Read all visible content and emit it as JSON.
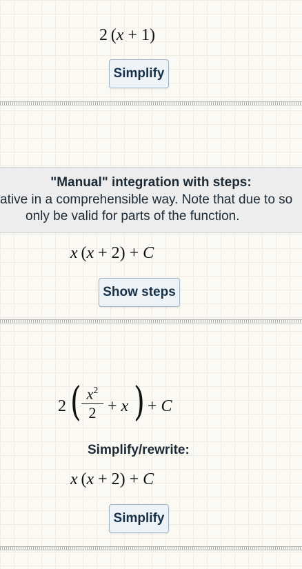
{
  "section1": {
    "expression": "2 (x + 1)",
    "simplify_button": "Simplify"
  },
  "banner": {
    "title": "\"Manual\" integration with steps:",
    "line1": "ative in a comprehensible way. Note that due to so",
    "line2": "only be valid for parts of the function."
  },
  "section2": {
    "result": "x (x + 2) + C",
    "show_steps_button": "Show steps"
  },
  "section3": {
    "expression": "2 (x²/2 + x) + C",
    "rewrite_label": "Simplify/rewrite:",
    "rewritten": "x (x + 2) + C",
    "simplify_button": "Simplify"
  }
}
